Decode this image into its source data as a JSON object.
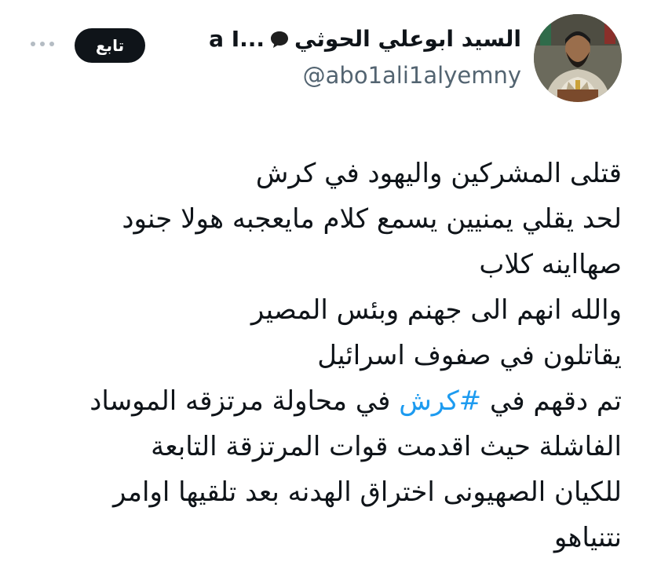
{
  "author": {
    "display_name": "السيد ابوعلي الحوثي",
    "name_suffix": "a I...",
    "handle": "@abo1ali1alyemny",
    "avatar_icon": "avatar-portrait"
  },
  "actions": {
    "follow_label": "تابع",
    "more_icon": "more-horizontal-icon"
  },
  "tweet": {
    "lines": [
      "قتلى المشركين واليهود في كرش",
      "لحد يقلي يمنيين يسمع كلام مايعجبه هولا جنود",
      "صهااينه كلاب",
      "والله انهم الى جهنم وبئس المصير",
      "يقاتلون في صفوف اسرائيل"
    ],
    "line6_before": "تم دقهم في ",
    "hashtag": "#كرش",
    "line6_after": " في محاولة مرتزقه الموساد",
    "lines_after": [
      "الفاشلة حيث اقدمت قوات المرتزقة التابعة",
      "للكيان الصهيونى اختراق الهدنه بعد تلقيها اوامر",
      "نتنياهو"
    ]
  },
  "colors": {
    "text": "#0f1419",
    "secondary": "#536471",
    "link": "#1d9bf0",
    "button_bg": "#0f1419"
  }
}
